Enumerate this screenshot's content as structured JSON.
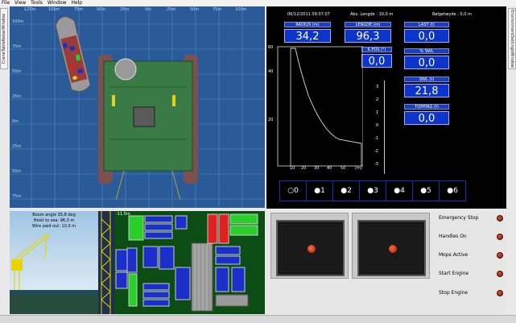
{
  "menu": [
    "File",
    "View",
    "Tools",
    "Window",
    "Help"
  ],
  "left_tab": "CraneTableRebarWindow",
  "right_tab": "EnvironmentSettingsWindow",
  "map": {
    "top_ruler": [
      "125m",
      "100m",
      "75m",
      "50m",
      "25m",
      "0m",
      "25m",
      "50m",
      "75m",
      "100m"
    ],
    "side_ruler": [
      "100m",
      "75m",
      "50m",
      "25m",
      "0m",
      "25m",
      "50m",
      "75m"
    ]
  },
  "scada": {
    "date": "06/12/2011 09:07:07",
    "abs_length": "Abs. Lengde : 10,0 m",
    "wave_height": "Bølgehøyde : 0,0 m",
    "radius_label": "RADIUS (m)",
    "radius_value": "34,2",
    "lengde_label": "LENGDE (m)",
    "lengde_value": "96,3",
    "last_label": "LAST (t)",
    "last_value": "0,0",
    "kpos_label": "K.POS (°)",
    "kpos_value": "0,0",
    "swl_pct_label": "% SWL",
    "swl_pct_value": "0,0",
    "swl_label": "SWL (t)",
    "swl_value": "21,8",
    "topping_label": "TOPPING (t)",
    "topping_value": "0,0",
    "chart_y_ticks": [
      "60",
      "40",
      "20"
    ],
    "chart_x_ticks": [
      "10",
      "20",
      "30",
      "40",
      "50"
    ],
    "chart_x_unit": "(m)",
    "scale_ticks": [
      "3",
      "2",
      "1",
      "0",
      "-1",
      "-2",
      "-3"
    ],
    "gears": [
      "0",
      "1",
      "2",
      "3",
      "4",
      "5",
      "6"
    ]
  },
  "camera": {
    "boom_angle": "Boom angle 35,8 deg",
    "hoist": "Hoist to sea: 96,3 m",
    "wire": "Wire paid out: 10,0 m"
  },
  "deck": {
    "label": "-11.5m"
  },
  "indicators": [
    {
      "label": "Emergency Stop"
    },
    {
      "label": "Handles On"
    },
    {
      "label": "Mops Active"
    },
    {
      "label": "Start Engine"
    },
    {
      "label": "Stop Engine"
    }
  ]
}
